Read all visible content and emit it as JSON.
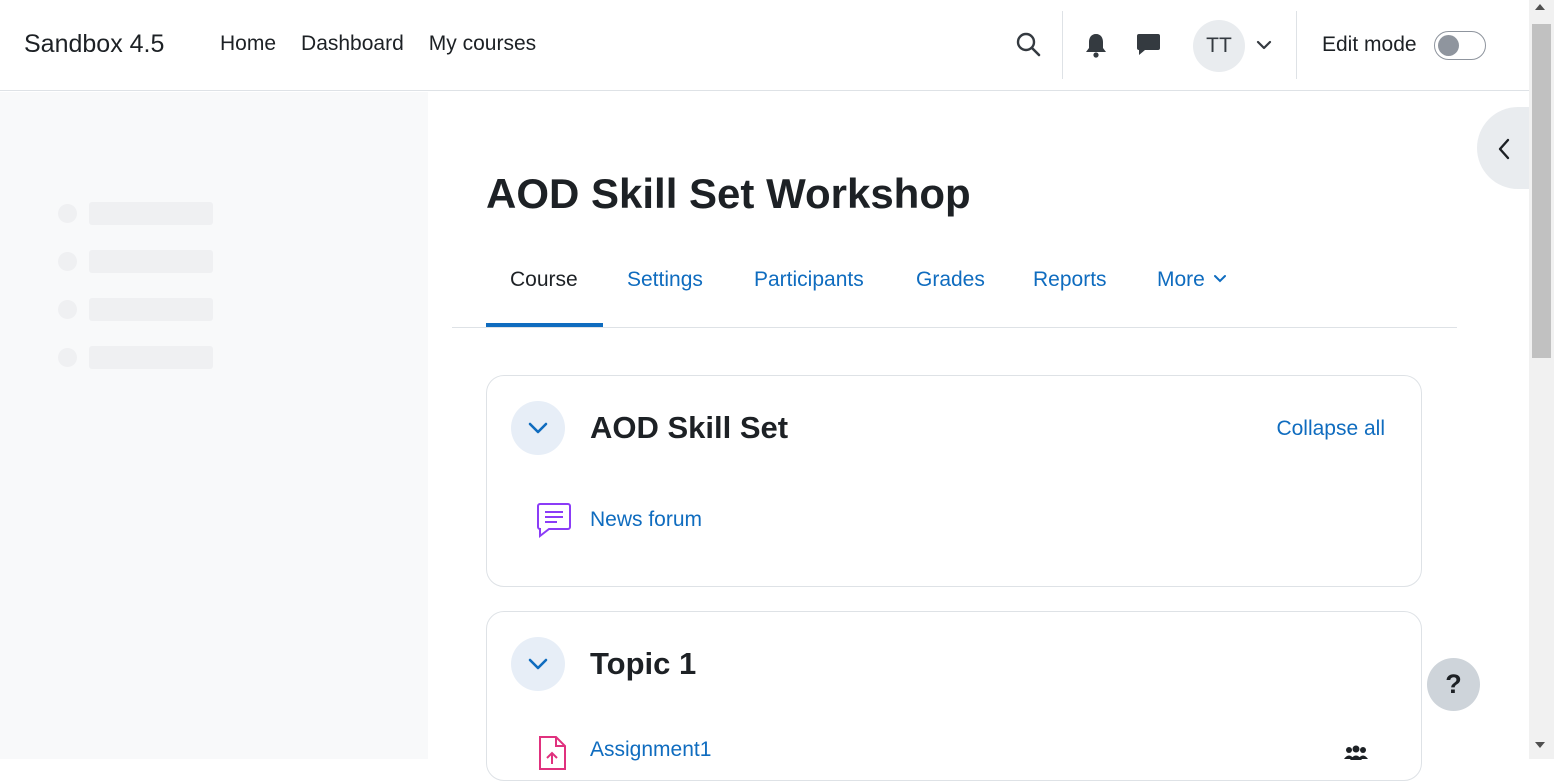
{
  "navbar": {
    "brand": "Sandbox 4.5",
    "links": [
      "Home",
      "Dashboard",
      "My courses"
    ],
    "user_initials": "TT",
    "edit_mode_label": "Edit mode",
    "edit_mode_on": false,
    "icons": [
      "search-icon",
      "bell-icon",
      "message-icon",
      "chevron-down-icon"
    ]
  },
  "course": {
    "title": "AOD Skill Set Workshop",
    "tabs": [
      {
        "label": "Course",
        "active": true
      },
      {
        "label": "Settings",
        "active": false
      },
      {
        "label": "Participants",
        "active": false
      },
      {
        "label": "Grades",
        "active": false
      },
      {
        "label": "Reports",
        "active": false
      },
      {
        "label": "More",
        "active": false
      }
    ]
  },
  "sections": [
    {
      "title": "AOD Skill Set",
      "collapse_all": "Collapse all",
      "activities": [
        {
          "name": "News forum",
          "icon": "forum-icon"
        }
      ]
    },
    {
      "title": "Topic 1",
      "activities": [
        {
          "name": "Assignment1",
          "icon": "assignment-icon",
          "group_icon": "group-icon"
        }
      ]
    }
  ],
  "help": {
    "label": "?"
  },
  "colors": {
    "link": "#0f6cbf",
    "text": "#1d2125",
    "drawer_bg": "#f8f9fa",
    "forum_icon": "#8b3cf7",
    "assignment_icon": "#e0317e"
  }
}
